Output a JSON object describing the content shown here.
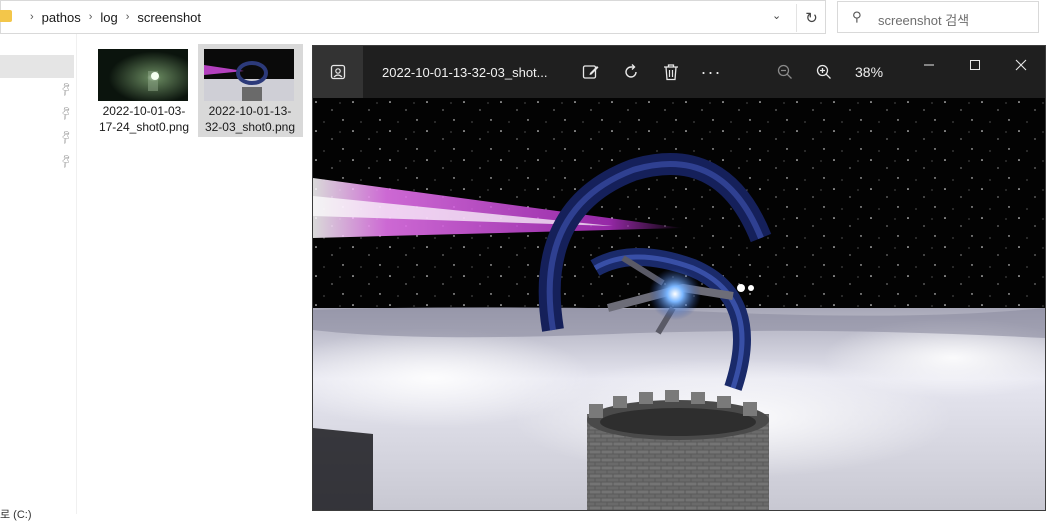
{
  "explorer": {
    "breadcrumbs": [
      "pathos",
      "log",
      "screenshot"
    ],
    "search_placeholder": "screenshot 검색",
    "drive_label": "로 (C:)",
    "files": [
      {
        "name_line1": "2022-10-01-03-",
        "name_line2": "17-24_shot0.png"
      },
      {
        "name_line1": "2022-10-01-13-",
        "name_line2": "32-03_shot0.png"
      }
    ]
  },
  "viewer": {
    "title": "2022-10-01-13-32-03_shot...",
    "zoom": "38%",
    "icons": [
      "image-icon",
      "edit-icon",
      "rotate-icon",
      "delete-icon",
      "more-icon",
      "zoom-out-icon",
      "zoom-in-icon",
      "minimize-icon",
      "maximize-icon",
      "close-icon"
    ]
  },
  "colors": {
    "folder": "#f3c64a",
    "viewer_bar": "#1f1f1f",
    "selection": "#d9d9d9"
  }
}
